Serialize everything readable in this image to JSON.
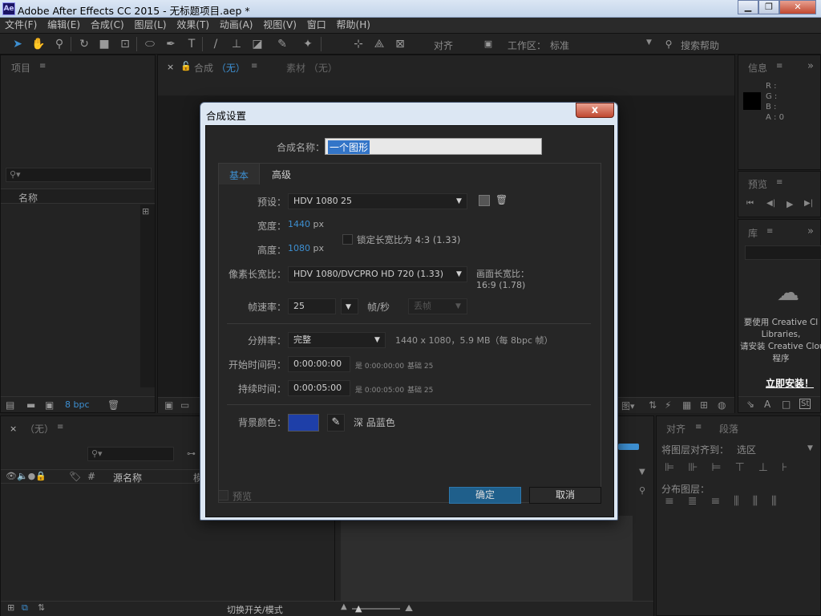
{
  "titlebar": {
    "icon": "Ae",
    "title": "Adobe After Effects CC 2015 - 无标题项目.aep *",
    "min": "▁",
    "restore": "❐",
    "close": "✕"
  },
  "menu": [
    "文件(F)",
    "编辑(E)",
    "合成(C)",
    "图层(L)",
    "效果(T)",
    "动画(A)",
    "视图(V)",
    "窗口",
    "帮助(H)"
  ],
  "toolbar": {
    "align_label": "对齐",
    "workspace_label": "工作区：",
    "workspace_value": "标准",
    "search_placeholder": "搜索帮助"
  },
  "project_panel": {
    "tab": "项目",
    "col_name": "名称",
    "bpc": "8 bpc"
  },
  "comp_panel": {
    "tab": "合成",
    "tab_value": "（无）",
    "footage_tab": "素材",
    "footage_value": "（无）"
  },
  "info_panel": {
    "tab": "信息",
    "r": "R :",
    "g": "G :",
    "b": "B :",
    "a": "A : 0"
  },
  "preview_panel": {
    "tab": "预览"
  },
  "library_panel": {
    "tab": "库",
    "msg1": "要使用 Creative Cl",
    "msg2": "Libraries,",
    "msg3": "请安装 Creative Clou",
    "msg4": "程序",
    "install": "立即安装！"
  },
  "timeline_panel": {
    "tab": "（无）",
    "col_source": "源名称",
    "col_hash": "#",
    "col_mode": "模",
    "toggle": "切换开关/模式"
  },
  "align_panel": {
    "tab": "对齐",
    "tab2": "段落",
    "align_to": "将图层对齐到：",
    "align_to_value": "选区",
    "distribute": "分布图层："
  },
  "dialog": {
    "title": "合成设置",
    "close": "x",
    "name_label": "合成名称：",
    "name_value": "一个图形",
    "tab_basic": "基本",
    "tab_advanced": "高级",
    "preset_label": "预设：",
    "preset_value": "HDV 1080 25",
    "width_label": "宽度：",
    "width_value": "1440",
    "width_unit": "px",
    "height_label": "高度：",
    "height_value": "1080",
    "height_unit": "px",
    "lock_label": "锁定长宽比为 4:3 (1.33)",
    "par_label": "像素长宽比：",
    "par_value": "HDV 1080/DVCPRO HD 720 (1.33)",
    "frame_aspect_label": "画面长宽比：",
    "frame_aspect_value": "16:9 (1.78)",
    "fps_label": "帧速率：",
    "fps_value": "25",
    "fps_unit": "帧/秒",
    "drop_frame": "丢帧",
    "res_label": "分辨率：",
    "res_value": "完整",
    "res_info": "1440 x 1080，5.9 MB（每 8bpc 帧）",
    "start_label": "开始时间码：",
    "start_value": "0:00:00:00",
    "start_info": "是 0:00:00:00",
    "start_base": "基础 25",
    "dur_label": "持续时间：",
    "dur_value": "0:00:05:00",
    "dur_info": "是 0:00:05:00",
    "dur_base": "基础 25",
    "bg_label": "背景颜色：",
    "bg_color": "#1e3fa8",
    "bg_name": "深 品蓝色",
    "preview_label": "预览",
    "ok": "确定",
    "cancel": "取消"
  },
  "colors": {
    "accent": "#3d8fd1",
    "ok_button": "#1f5f8b"
  }
}
